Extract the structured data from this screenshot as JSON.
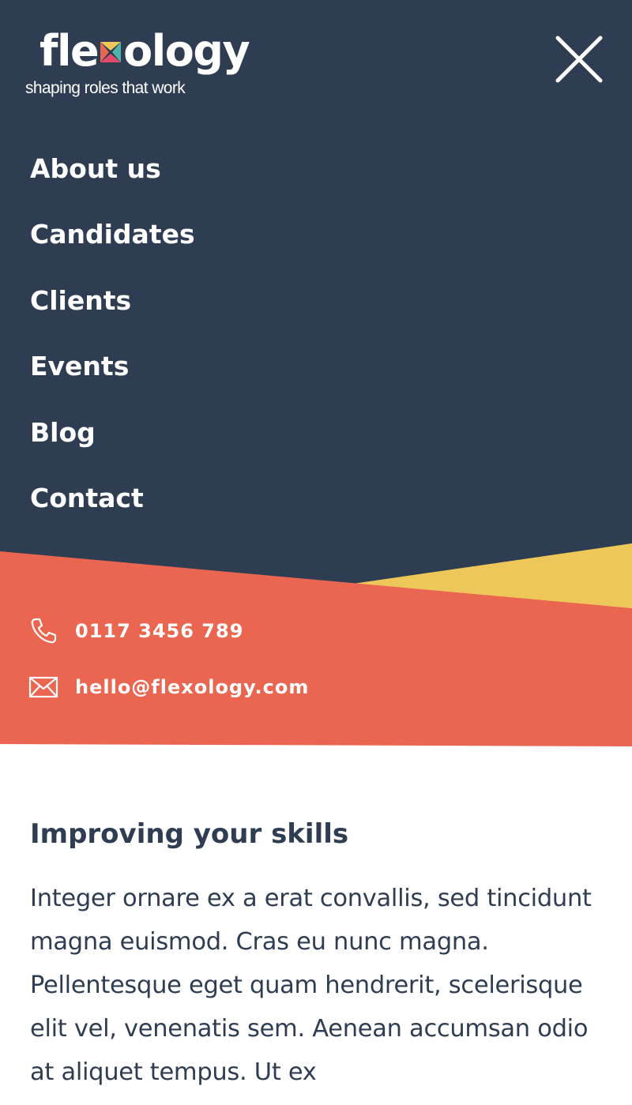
{
  "brand": {
    "name_part1": "fle",
    "name_part2": "ology",
    "tagline": "shaping roles that work"
  },
  "nav": {
    "items": [
      {
        "label": "About us"
      },
      {
        "label": "Candidates"
      },
      {
        "label": "Clients"
      },
      {
        "label": "Events"
      },
      {
        "label": "Blog"
      },
      {
        "label": "Contact"
      }
    ],
    "close_icon": "close-icon"
  },
  "contact": {
    "phone": "0117 3456 789",
    "email": "hello@flexology.com",
    "phone_icon": "phone-icon",
    "email_icon": "envelope-icon"
  },
  "article": {
    "heading": "Improving your skills",
    "body": "Integer ornare ex a erat convallis, sed tincidunt magna euismod. Cras eu nunc magna. Pellentesque eget quam hendrerit, scelerisque elit vel, venenatis sem. Aenean accumsan odio at aliquet tempus. Ut ex"
  },
  "colors": {
    "navy": "#2e3d51",
    "coral": "#ea6650",
    "yellow": "#eec75a",
    "white": "#ffffff"
  }
}
